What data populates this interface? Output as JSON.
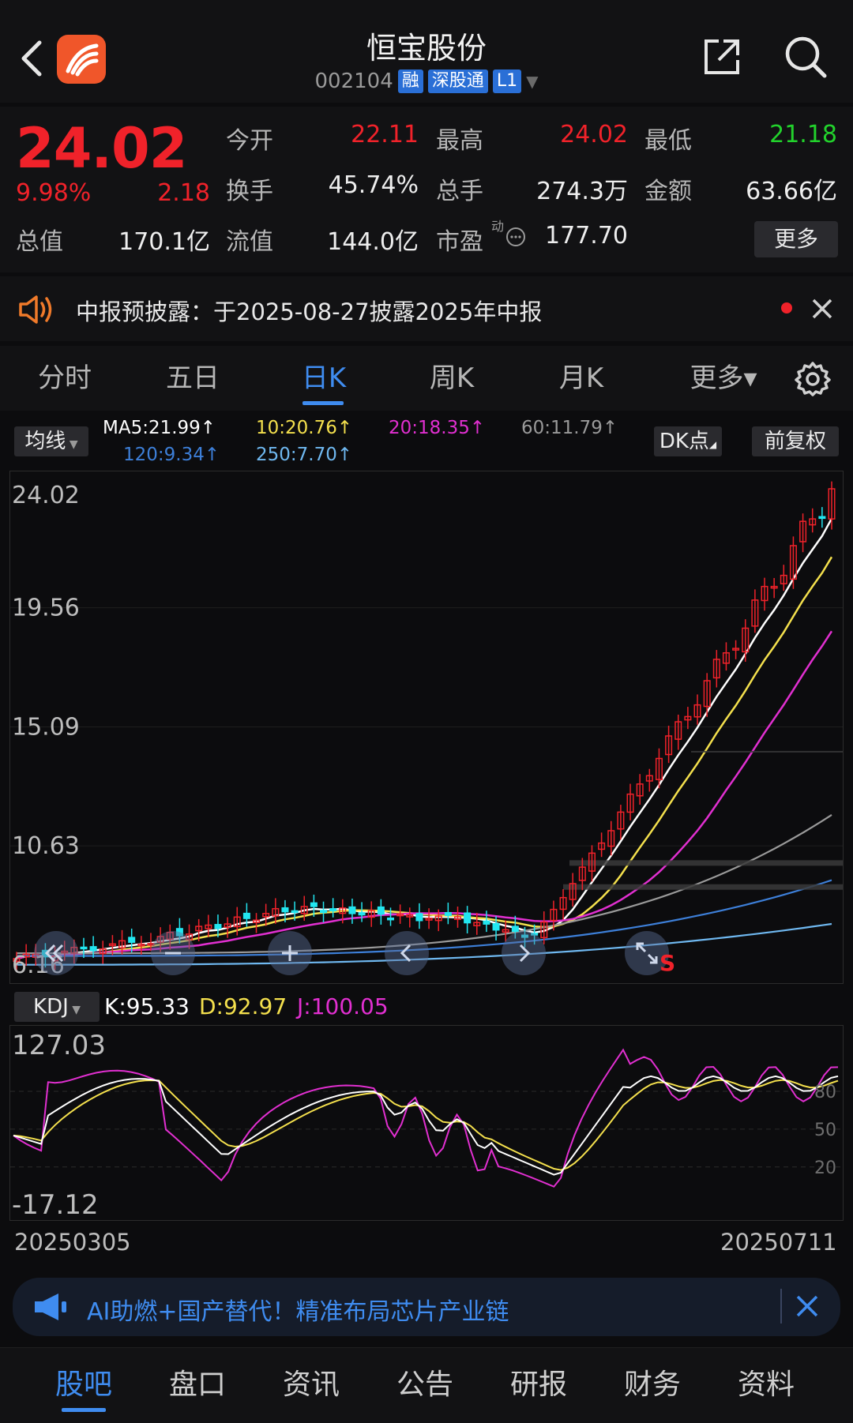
{
  "header": {
    "stock_name": "恒宝股份",
    "code": "002104",
    "tags": [
      "融",
      "深股通",
      "L1"
    ]
  },
  "quote": {
    "price": "24.02",
    "change_pct": "9.98%",
    "change": "2.18",
    "open_label": "今开",
    "open": "22.11",
    "high_label": "最高",
    "high": "24.02",
    "low_label": "最低",
    "low": "21.18",
    "turnover_label": "换手",
    "turnover": "45.74%",
    "volume_label": "总手",
    "volume": "274.3万",
    "amount_label": "金额",
    "amount": "63.66亿",
    "mktcap_label": "总值",
    "mktcap": "170.1亿",
    "float_label": "流值",
    "float": "144.0亿",
    "pe_label": "市盈",
    "pe_sup": "动",
    "pe": "177.70",
    "more_label": "更多"
  },
  "notice": {
    "text": "中报预披露：于2025-08-27披露2025年中报"
  },
  "tabs": [
    "分时",
    "五日",
    "日K",
    "周K",
    "月K",
    "更多▾"
  ],
  "ma": {
    "type_label": "均线",
    "ma5": "MA5:21.99↑",
    "ma10": "10:20.76↑",
    "ma20": "20:18.35↑",
    "ma60": "60:11.79↑",
    "ma120": "120:9.34↑",
    "ma250": "250:7.70↑",
    "dk_label": "DK点",
    "adjust_label": "前复权"
  },
  "colors": {
    "up": "#f0222a",
    "down": "#22e6f0",
    "ma5": "#ffffff",
    "ma10": "#f4e04d",
    "ma20": "#e12fd0",
    "ma60": "#9a9a9a",
    "ma120": "#3d7fd8",
    "ma250": "#6fb8f0"
  },
  "chart": {
    "y_labels": [
      "24.02",
      "19.56",
      "15.09",
      "10.63",
      "6.16"
    ],
    "date_start": "20250305",
    "date_end": "20250711",
    "signal_label": "S"
  },
  "kdj": {
    "label": "KDJ",
    "k": "K:95.33",
    "d": "D:92.97",
    "j": "J:100.05",
    "max": "127.03",
    "min": "-17.12",
    "levels": [
      "80",
      "50",
      "20"
    ]
  },
  "banner": {
    "text": "AI助燃+国产替代！精准布局芯片产业链"
  },
  "bottom_nav": [
    "股吧",
    "盘口",
    "资讯",
    "公告",
    "研报",
    "财务",
    "资料"
  ]
}
